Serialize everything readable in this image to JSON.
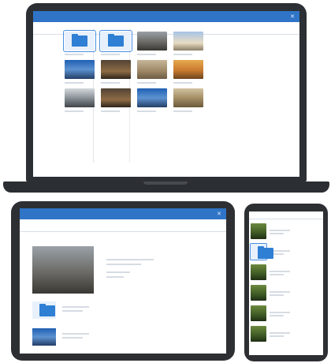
{
  "laptop": {
    "title": "",
    "nav": {
      "tabs": [
        "",
        "",
        ""
      ],
      "action": ""
    },
    "tiles": [
      {
        "kind": "folder",
        "tint": "folder",
        "selected": true,
        "caption": ""
      },
      {
        "kind": "folder",
        "tint": "folder",
        "selected": true,
        "caption": ""
      },
      {
        "kind": "photo",
        "tint": "p-city",
        "selected": false,
        "caption": ""
      },
      {
        "kind": "photo",
        "tint": "p-sky",
        "selected": false,
        "caption": ""
      },
      {
        "kind": "photo",
        "tint": "p-blue",
        "selected": false,
        "caption": ""
      },
      {
        "kind": "photo",
        "tint": "p-dark",
        "selected": false,
        "caption": ""
      },
      {
        "kind": "photo",
        "tint": "p-sand",
        "selected": false,
        "caption": ""
      },
      {
        "kind": "photo",
        "tint": "p-orange",
        "selected": false,
        "caption": ""
      },
      {
        "kind": "photo",
        "tint": "p-mist",
        "selected": false,
        "caption": ""
      },
      {
        "kind": "photo",
        "tint": "p-dark",
        "selected": false,
        "caption": ""
      },
      {
        "kind": "photo",
        "tint": "p-blue",
        "selected": false,
        "caption": ""
      },
      {
        "kind": "photo",
        "tint": "p-stone",
        "selected": false,
        "caption": ""
      }
    ]
  },
  "tablet": {
    "title": "",
    "nav": {
      "tabs": [
        "",
        "",
        ""
      ],
      "action": ""
    },
    "filter": "",
    "count": "",
    "hero_title": "",
    "rows": [
      {
        "tint": "folder",
        "title": ""
      },
      {
        "tint": "p-blue",
        "title": ""
      }
    ]
  },
  "phone": {
    "tabs": [
      "",
      ""
    ],
    "items": [
      {
        "tint": "p-green",
        "selected": false,
        "title": ""
      },
      {
        "tint": "folder",
        "selected": true,
        "title": ""
      },
      {
        "tint": "p-green",
        "selected": false,
        "title": ""
      },
      {
        "tint": "p-green",
        "selected": false,
        "title": ""
      },
      {
        "tint": "p-green",
        "selected": false,
        "title": ""
      },
      {
        "tint": "p-green",
        "selected": false,
        "title": ""
      }
    ]
  },
  "colors": {
    "accent": "#2f74c7",
    "device_frame": "#2c2f33",
    "folder": "#2f7fd4"
  },
  "icons": {
    "close": "close-icon",
    "folder": "folder-icon"
  }
}
